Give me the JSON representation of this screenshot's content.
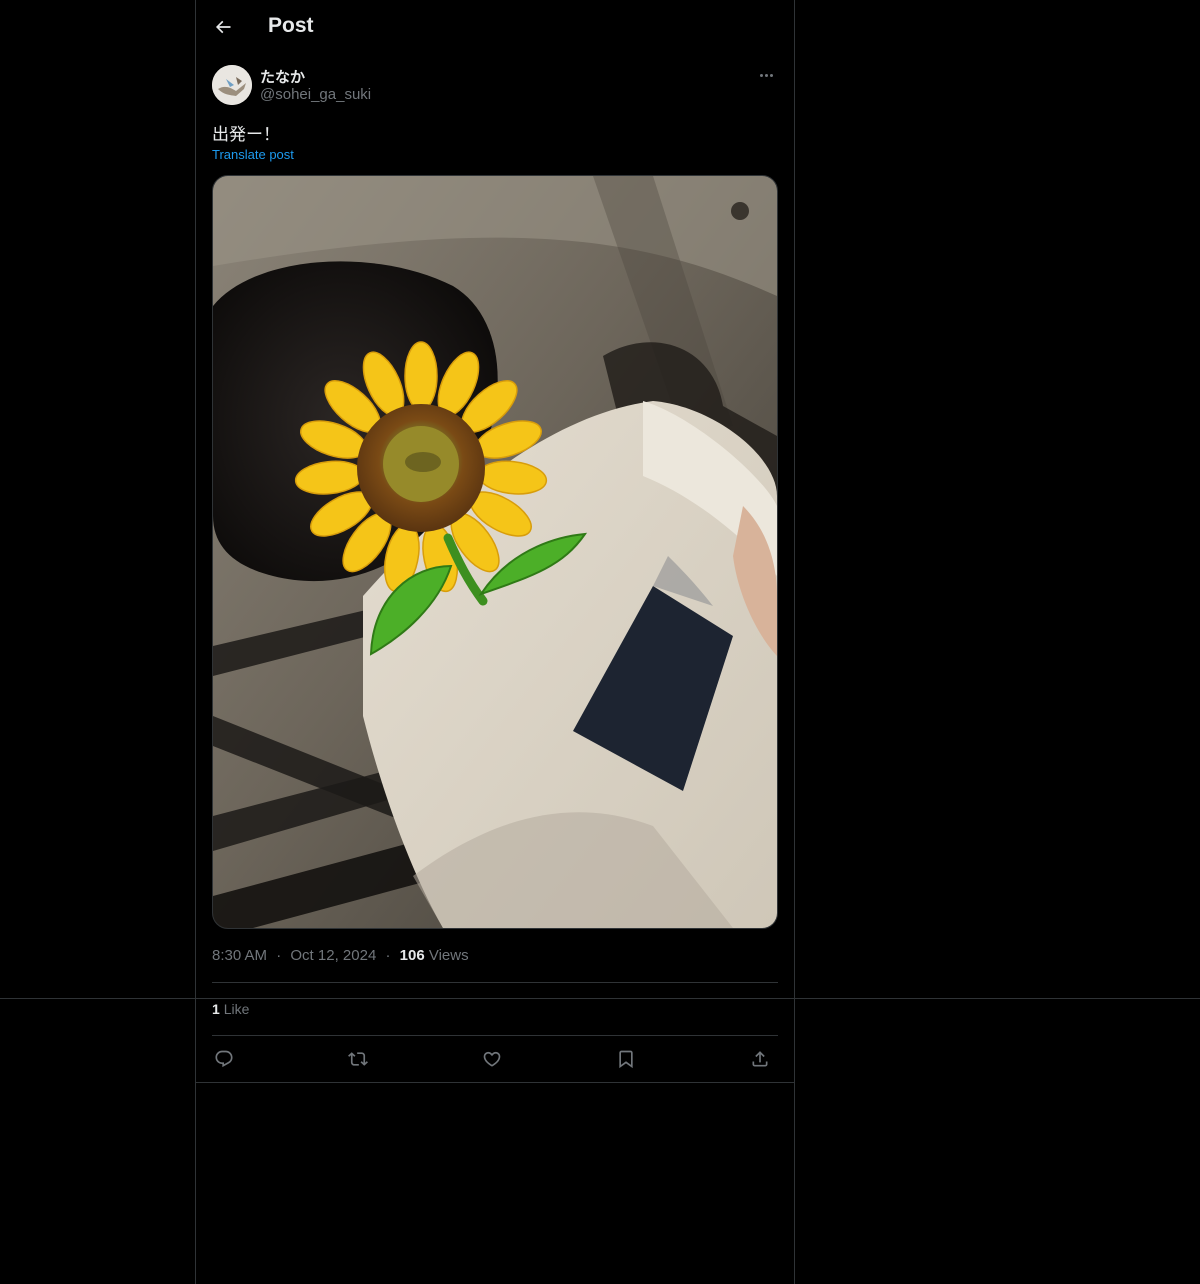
{
  "header": {
    "title": "Post",
    "back_icon": "arrow-left-icon"
  },
  "author": {
    "display_name": "たなか",
    "handle": "@sohei_ga_suki"
  },
  "post": {
    "text": "出発ー！",
    "translate_label": "Translate post"
  },
  "meta": {
    "time": "8:30 AM",
    "separator": "·",
    "date": "Oct 12, 2024",
    "views_count": "106",
    "views_label": "Views"
  },
  "engagement": {
    "likes_count": "1",
    "likes_label": "Like"
  },
  "actions": [
    "reply-icon",
    "repost-icon",
    "like-icon",
    "bookmark-icon",
    "share-icon"
  ],
  "colors": {
    "background": "#000000",
    "text": "#e7e9ea",
    "muted": "#71767b",
    "accent": "#1d9bf0",
    "border": "#2f3336"
  }
}
